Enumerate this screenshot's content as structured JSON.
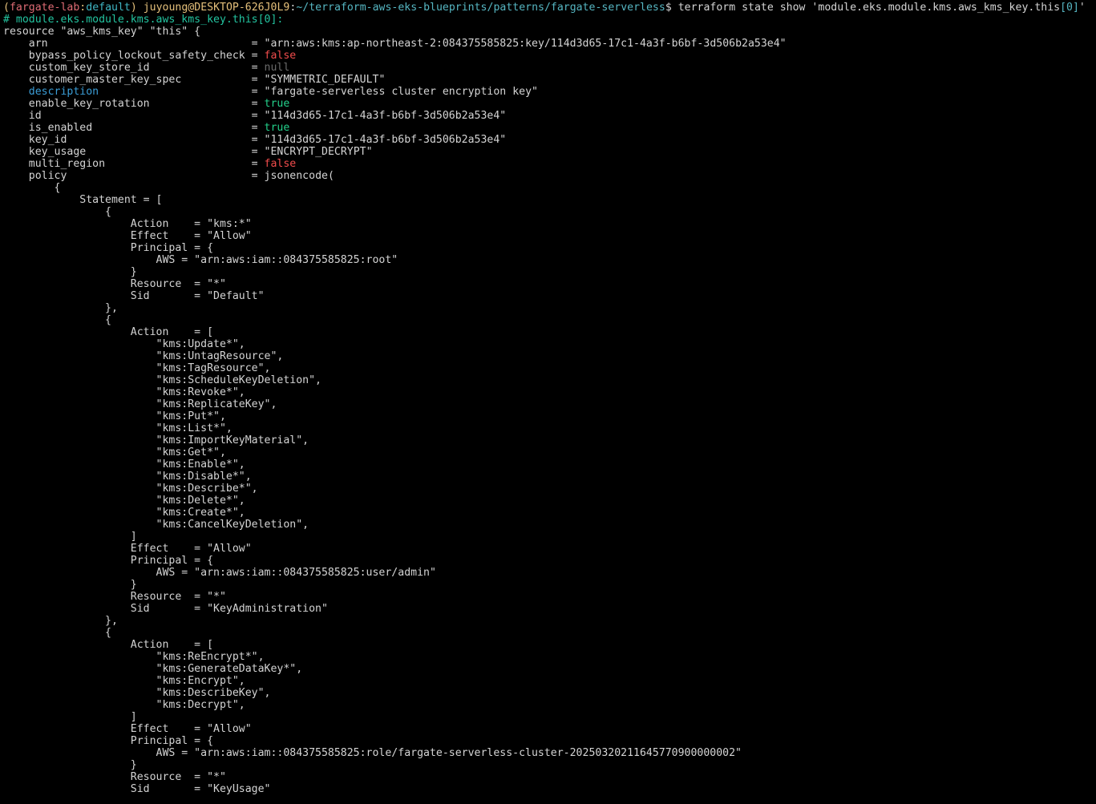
{
  "prompt": {
    "paren_open": "(",
    "env": "fargate-lab",
    "colon": ":",
    "profile": "default",
    "paren_close": ")",
    "user_host": "juyoung@DESKTOP-626J0L9",
    "path_sep": ":",
    "path": "~/terraform-aws-eks-blueprints/patterns/fargate-serverless",
    "dollar": "$",
    "command_prefix": " terraform state show 'module.eks.module.kms.aws_kms_key.this",
    "command_index": "[0]",
    "command_suffix": "'"
  },
  "comment_line": "# module.eks.module.kms.aws_kms_key.this[0]:",
  "resource_header": "resource \"aws_kms_key\" \"this\" {",
  "attributes": [
    {
      "key": "arn",
      "value": "\"arn:aws:kms:ap-northeast-2:084375585825:key/114d3d65-17c1-4a3f-b6bf-3d506b2a53e4\"",
      "key_color": "white",
      "value_color": "white"
    },
    {
      "key": "bypass_policy_lockout_safety_check",
      "value": "false",
      "key_color": "white",
      "value_color": "red"
    },
    {
      "key": "custom_key_store_id",
      "value": "null",
      "key_color": "white",
      "value_color": "gray"
    },
    {
      "key": "customer_master_key_spec",
      "value": "\"SYMMETRIC_DEFAULT\"",
      "key_color": "white",
      "value_color": "white"
    },
    {
      "key": "description",
      "value": "\"fargate-serverless cluster encryption key\"",
      "key_color": "blue",
      "value_color": "white"
    },
    {
      "key": "enable_key_rotation",
      "value": "true",
      "key_color": "white",
      "value_color": "green"
    },
    {
      "key": "id",
      "value": "\"114d3d65-17c1-4a3f-b6bf-3d506b2a53e4\"",
      "key_color": "white",
      "value_color": "white"
    },
    {
      "key": "is_enabled",
      "value": "true",
      "key_color": "white",
      "value_color": "green"
    },
    {
      "key": "key_id",
      "value": "\"114d3d65-17c1-4a3f-b6bf-3d506b2a53e4\"",
      "key_color": "white",
      "value_color": "white"
    },
    {
      "key": "key_usage",
      "value": "\"ENCRYPT_DECRYPT\"",
      "key_color": "white",
      "value_color": "white"
    },
    {
      "key": "multi_region",
      "value": "false",
      "key_color": "white",
      "value_color": "red"
    },
    {
      "key": "policy",
      "value": "jsonencode(",
      "key_color": "white",
      "value_color": "white"
    }
  ],
  "policy_lines": [
    "        {",
    "            Statement = [",
    "                {",
    "                    Action    = \"kms:*\"",
    "                    Effect    = \"Allow\"",
    "                    Principal = {",
    "                        AWS = \"arn:aws:iam::084375585825:root\"",
    "                    }",
    "                    Resource  = \"*\"",
    "                    Sid       = \"Default\"",
    "                },",
    "                {",
    "                    Action    = [",
    "                        \"kms:Update*\",",
    "                        \"kms:UntagResource\",",
    "                        \"kms:TagResource\",",
    "                        \"kms:ScheduleKeyDeletion\",",
    "                        \"kms:Revoke*\",",
    "                        \"kms:ReplicateKey\",",
    "                        \"kms:Put*\",",
    "                        \"kms:List*\",",
    "                        \"kms:ImportKeyMaterial\",",
    "                        \"kms:Get*\",",
    "                        \"kms:Enable*\",",
    "                        \"kms:Disable*\",",
    "                        \"kms:Describe*\",",
    "                        \"kms:Delete*\",",
    "                        \"kms:Create*\",",
    "                        \"kms:CancelKeyDeletion\",",
    "                    ]",
    "                    Effect    = \"Allow\"",
    "                    Principal = {",
    "                        AWS = \"arn:aws:iam::084375585825:user/admin\"",
    "                    }",
    "                    Resource  = \"*\"",
    "                    Sid       = \"KeyAdministration\"",
    "                },",
    "                {",
    "                    Action    = [",
    "                        \"kms:ReEncrypt*\",",
    "                        \"kms:GenerateDataKey*\",",
    "                        \"kms:Encrypt\",",
    "                        \"kms:DescribeKey\",",
    "                        \"kms:Decrypt\",",
    "                    ]",
    "                    Effect    = \"Allow\"",
    "                    Principal = {",
    "                        AWS = \"arn:aws:iam::084375585825:role/fargate-serverless-cluster-20250320211645770900000002\"",
    "                    }",
    "                    Resource  = \"*\"",
    "                    Sid       = \"KeyUsage\""
  ],
  "colors": {
    "background": "#000000",
    "foreground": "#d4d4d4",
    "env": "#e06c75",
    "prompt_yellow": "#e5c07b",
    "path": "#56b6c2",
    "comment": "#23c4a0",
    "true": "#23d18b",
    "false": "#f14c4c",
    "null": "#6b6b6b",
    "description_key": "#3b9dd6"
  }
}
